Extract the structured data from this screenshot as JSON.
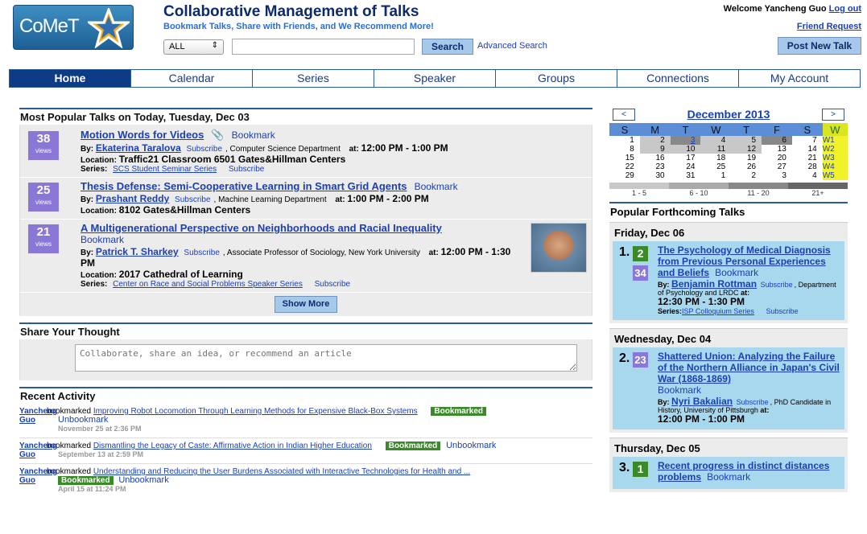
{
  "header": {
    "logo_text": "CoMeT",
    "title": "Collaborative Management of Talks",
    "tagline": "Bookmark Talks, Share with Friends, and We Recommend More!",
    "search_scope": "ALL",
    "search_label": "Search",
    "advanced_search": "Advanced Search",
    "welcome": "Welcome Yancheng Guo",
    "logout": "Log out",
    "friend_request": "Friend Request",
    "post_talk": "Post New Talk"
  },
  "nav": [
    "Home",
    "Calendar",
    "Series",
    "Speaker",
    "Groups",
    "Connections",
    "My Account"
  ],
  "popular": {
    "heading": "Most Popular Talks on Today, Tuesday, Dec 03",
    "show_more": "Show More",
    "talks": [
      {
        "views": "38",
        "views_label": "views",
        "title": "Motion Words for Videos",
        "bookmark": "Bookmark",
        "by_label": "By:",
        "speaker": "Ekaterina Taralova",
        "subscribe": "Subscribe",
        "affil": ", Computer Science Department",
        "at_label": "at:",
        "time": "12:00 PM - 1:00 PM",
        "loc_label": "Location:",
        "location": "Traffic21 Classroom 6501  Gates&Hillman Centers",
        "series_label": "Series:",
        "series": "SCS Student Seminar Series",
        "series_subscribe": "Subscribe"
      },
      {
        "views": "25",
        "views_label": "views",
        "title": "Thesis Defense: Semi-Cooperative Learning in Smart Grid Agents",
        "bookmark": "Bookmark",
        "by_label": "By:",
        "speaker": "Prashant Reddy",
        "subscribe": "Subscribe",
        "affil": ", Machine Learning Department",
        "at_label": "at:",
        "time": "1:00 PM - 2:00 PM",
        "loc_label": "Location:",
        "location": "8102  Gates&Hillman Centers"
      },
      {
        "views": "21",
        "views_label": "views",
        "title": "A Multigenerational Perspective on Neighborhoods and Racial Inequality",
        "bookmark": "Bookmark",
        "by_label": "By:",
        "speaker": "Patrick T. Sharkey",
        "subscribe": "Subscribe",
        "affil": ", Associate Professor of Sociology, New York University",
        "at_label": "at:",
        "time": "12:00 PM - 1:30 PM",
        "loc_label": "Location:",
        "location": "2017 Cathedral of Learning",
        "series_label": "Series:",
        "series": "Center on Race and Social Problems Speaker Series",
        "series_subscribe": "Subscribe"
      }
    ]
  },
  "share": {
    "heading": "Share Your Thought",
    "placeholder": "Collaborate, share an idea, or recommend an article"
  },
  "recent": {
    "heading": "Recent Activity",
    "user_first": "Yancheng",
    "user_last": "Guo",
    "verb": "bookmarked",
    "badge": "Bookmarked",
    "unbookmark": "Unbookmark",
    "items": [
      {
        "title": "Improving Robot Locomotion Through Learning Methods for Expensive Black-Box Systems",
        "date": "November 25 at 2:36 PM"
      },
      {
        "title": "Dismantling the Legacy of Caste: Affirmative Action in Indian Higher Education",
        "date": "September 13 at 2:59 PM"
      },
      {
        "title": "Understanding and Reducing the User Burdens Associated with Interactive Technologies for Health and ...",
        "date": "April 15 at 11:24 PM"
      }
    ]
  },
  "calendar": {
    "prev": "<",
    "next": ">",
    "month": "December  2013",
    "days": [
      "S",
      "M",
      "T",
      "W",
      "T",
      "F",
      "S",
      "W"
    ],
    "weeks": [
      [
        "1",
        "2",
        "3",
        "4",
        "5",
        "6",
        "7",
        "W1"
      ],
      [
        "8",
        "9",
        "10",
        "11",
        "12",
        "13",
        "14",
        "W2"
      ],
      [
        "15",
        "16",
        "17",
        "18",
        "19",
        "20",
        "21",
        "W3"
      ],
      [
        "22",
        "23",
        "24",
        "25",
        "26",
        "27",
        "28",
        "W4"
      ],
      [
        "29",
        "30",
        "31",
        "1",
        "2",
        "3",
        "4",
        "W5"
      ]
    ],
    "legend": [
      "1 - 5",
      "6 - 10",
      "11 - 20",
      "21+"
    ],
    "legend_colors": [
      "#c8c8c8",
      "#aaaaaa",
      "#888888",
      "#666666"
    ]
  },
  "forthcoming": {
    "heading": "Popular Forthcoming Talks",
    "days": [
      {
        "day": "Friday, Dec 06",
        "rank": "1.",
        "count": "2",
        "views": "34",
        "title": "The Psychology of Medical Diagnosis from Previous Personal Experiences and Beliefs",
        "bookmark": "Bookmark",
        "by_label": "By:",
        "speaker": "Benjamin Rottman",
        "subscribe": "Subscribe",
        "affil": ", Department of Psychology and LRDC",
        "at_label": "at:",
        "time": "12:30 PM - 1:30 PM",
        "series_label": "Series:",
        "series": "ISP Colloquium Series",
        "series_subscribe": "Subscribe"
      },
      {
        "day": "Wednesday, Dec 04",
        "rank": "2.",
        "views": "23",
        "title": "Shattered Union: Analyzing the Failure of the Northern Alliance in Japan's Civil War (1868-1869)",
        "bookmark": "Bookmark",
        "by_label": "By:",
        "speaker": "Nyri Bakalian",
        "subscribe": "Subscribe",
        "affil": ", PhD Candidate in History, University of Pittsburgh",
        "at_label": "at:",
        "time": "12:00 PM - 1:00 PM"
      },
      {
        "day": "Thursday, Dec 05",
        "rank": "3.",
        "count": "1",
        "title": "Recent progress in distinct distances problems",
        "bookmark": "Bookmark"
      }
    ]
  }
}
